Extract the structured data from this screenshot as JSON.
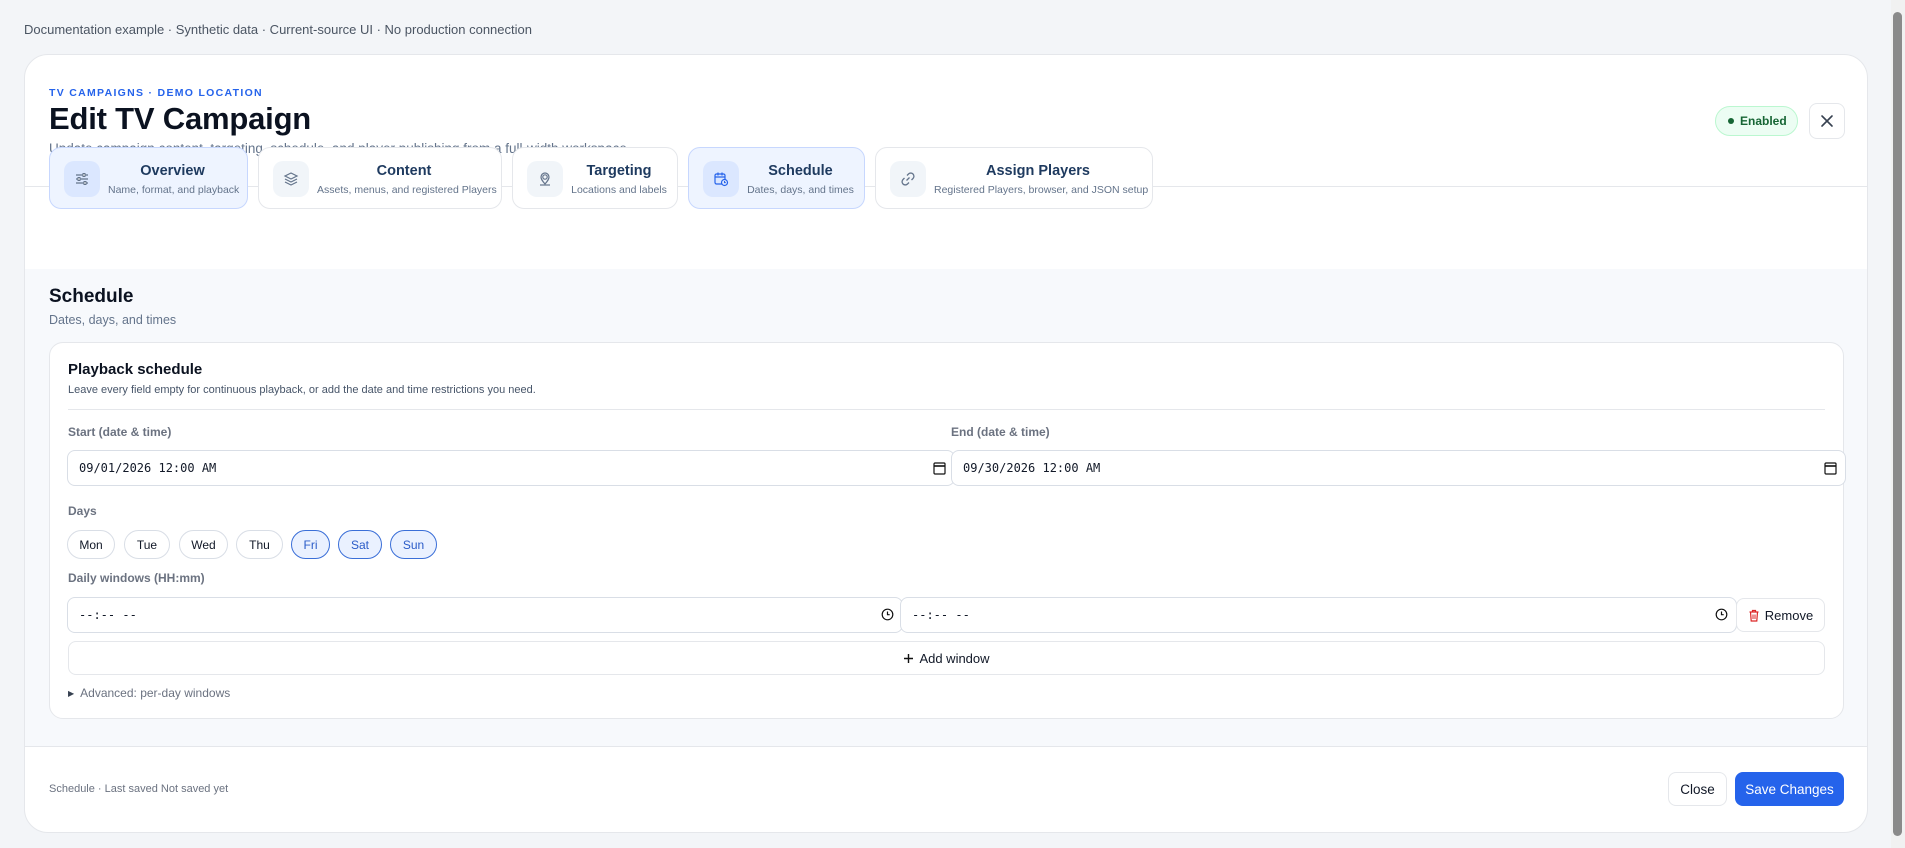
{
  "topnote": "Documentation example · Synthetic data · Current-source UI · No production connection",
  "header": {
    "eyebrow": "TV CAMPAIGNS · DEMO LOCATION",
    "title": "Edit TV Campaign",
    "subtitle": "Update campaign content, targeting, schedule, and player publishing from a full-width workspace.",
    "status_badge": "Enabled",
    "status_color": "#166534",
    "close_icon": "close-icon"
  },
  "tabs": [
    {
      "title": "Overview",
      "subtitle": "Name, format, and playback",
      "icon": "sliders-icon",
      "active": true
    },
    {
      "title": "Content",
      "subtitle": "Assets, menus, and registered Players",
      "icon": "layers-icon",
      "active": false
    },
    {
      "title": "Targeting",
      "subtitle": "Locations and labels",
      "icon": "location-pin-icon",
      "active": false
    },
    {
      "title": "Schedule",
      "subtitle": "Dates, days, and times",
      "icon": "calendar-clock-icon",
      "active": true
    },
    {
      "title": "Assign Players",
      "subtitle": "Registered Players, browser, and JSON setup",
      "icon": "link-icon",
      "active": false
    }
  ],
  "section": {
    "title": "Schedule",
    "subtitle": "Dates, days, and times"
  },
  "playback": {
    "title": "Playback schedule",
    "subtitle": "Leave every field empty for continuous playback, or add the date and time restrictions you need.",
    "start_label": "Start (date & time)",
    "start_value": "09/01/2026 12:00 AM",
    "end_label": "End (date & time)",
    "end_value": "09/30/2026 12:00 AM",
    "days_label": "Days",
    "days": [
      {
        "label": "Mon",
        "selected": false
      },
      {
        "label": "Tue",
        "selected": false
      },
      {
        "label": "Wed",
        "selected": false
      },
      {
        "label": "Thu",
        "selected": false
      },
      {
        "label": "Fri",
        "selected": true
      },
      {
        "label": "Sat",
        "selected": true
      },
      {
        "label": "Sun",
        "selected": true
      }
    ],
    "windows_label": "Daily windows (HH:mm)",
    "window_start": "--:-- --",
    "window_end": "--:-- --",
    "remove_label": "Remove",
    "add_window_label": "Add window",
    "advanced_label": "Advanced: per-day windows"
  },
  "footer": {
    "status": "Schedule · Last saved Not saved yet",
    "close_label": "Close",
    "save_label": "Save Changes"
  },
  "colors": {
    "accent": "#2563eb",
    "eyebrow": "#2563eb",
    "day_selected_border": "#3b6fd8",
    "remove_icon": "#dc2626"
  }
}
